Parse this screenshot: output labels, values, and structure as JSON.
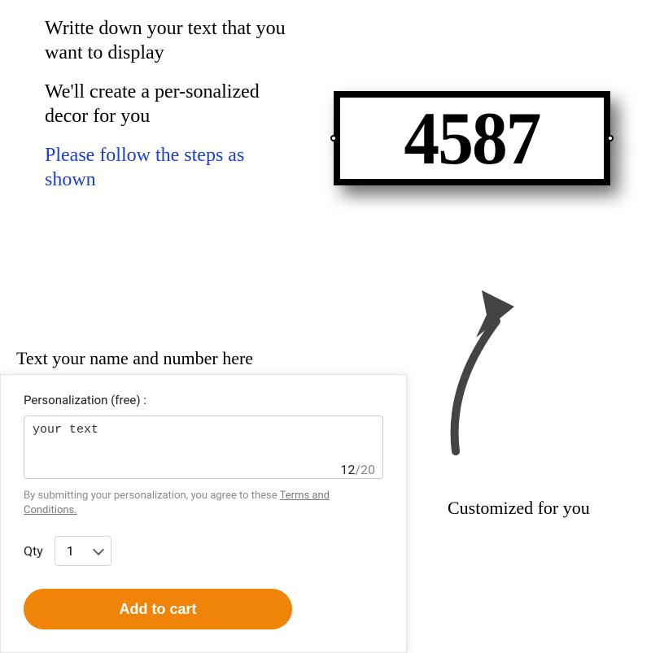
{
  "instructions": {
    "line1": "Writte down your text that you want to display",
    "line2": "We'll create a per-sonalized decor for you",
    "line3": "Please follow the steps as shown"
  },
  "input_caption": "Text your name and number here",
  "sign": {
    "number": "4587"
  },
  "arrow_caption": "Customized for you",
  "panel": {
    "label": "Personalization (free) :",
    "textarea_value": "your text",
    "char_count": "12",
    "char_max": "/20",
    "terms_prefix": "By submitting your personalization, you agree to these ",
    "terms_link": "Terms and Conditions.",
    "qty_label": "Qty",
    "qty_value": "1",
    "add_button": "Add to cart"
  }
}
